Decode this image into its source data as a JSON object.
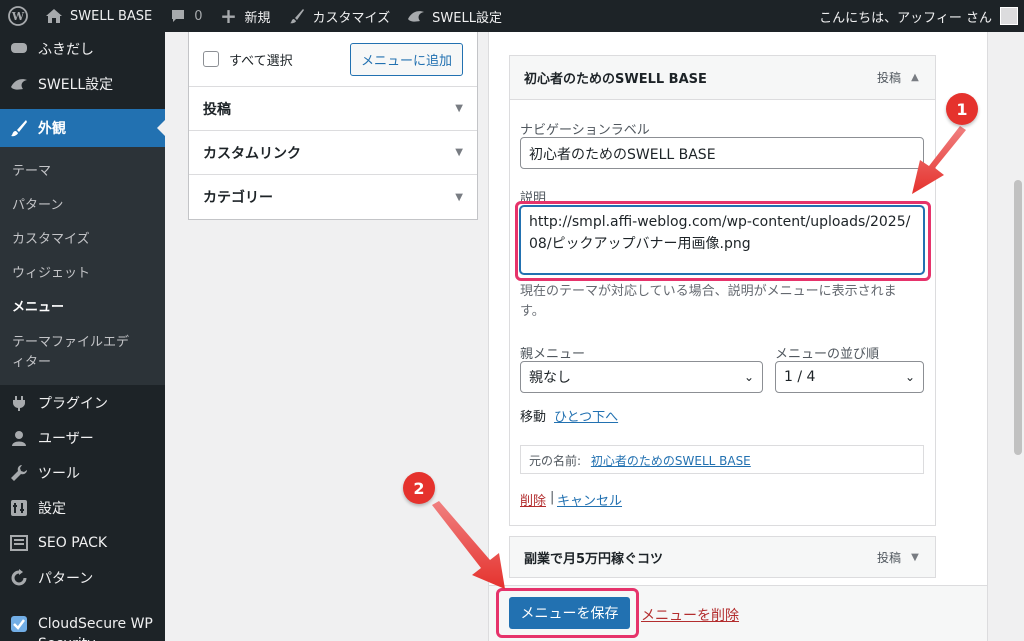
{
  "adminbar": {
    "site_name": "SWELL BASE",
    "comments_count": "0",
    "new_label": "新規",
    "customize_label": "カスタマイズ",
    "swell_settings_label": "SWELL設定",
    "greeting": "こんにちは、アッフィー さん"
  },
  "sidebar": {
    "items_top": [
      {
        "label": "ふきだし",
        "icon": "speech-bubble-icon"
      },
      {
        "label": "SWELL設定",
        "icon": "swell-icon"
      }
    ],
    "current": {
      "label": "外観",
      "icon": "paintbrush-icon"
    },
    "submenu": [
      "テーマ",
      "パターン",
      "カスタマイズ",
      "ウィジェット",
      "メニュー",
      "テーマファイルエディター"
    ],
    "submenu_active": "メニュー",
    "items_bottom": [
      {
        "label": "プラグイン",
        "icon": "plugin-icon"
      },
      {
        "label": "ユーザー",
        "icon": "user-icon"
      },
      {
        "label": "ツール",
        "icon": "wrench-icon"
      },
      {
        "label": "設定",
        "icon": "settings-icon"
      },
      {
        "label": "SEO PACK",
        "icon": "seo-icon"
      },
      {
        "label": "パターン",
        "icon": "pattern-icon"
      },
      {
        "label": "CloudSecure WP Security",
        "icon": "shield-icon"
      }
    ]
  },
  "left_panel": {
    "select_all": "すべて選択",
    "add_to_menu": "メニューに追加",
    "sections": [
      "投稿",
      "カスタムリンク",
      "カテゴリー"
    ]
  },
  "menu_item_1": {
    "title": "初心者のためのSWELL BASE",
    "type": "投稿",
    "nav_label_caption": "ナビゲーションラベル",
    "nav_label_value": "初心者のためのSWELL BASE",
    "description_caption": "説明",
    "description_value": "http://smpl.affi-weblog.com/wp-content/uploads/2025/08/ピックアップバナー用画像.png",
    "description_help": "現在のテーマが対応している場合、説明がメニューに表示されます。",
    "parent_caption": "親メニュー",
    "parent_value": "親なし",
    "order_caption": "メニューの並び順",
    "order_value": "1 / 4",
    "move_caption": "移動",
    "move_link": "ひとつ下へ",
    "original_caption": "元の名前:",
    "original_link": "初心者のためのSWELL BASE",
    "delete_link": "削除",
    "separator": "|",
    "cancel_link": "キャンセル"
  },
  "menu_item_2": {
    "title": "副業で月5万円稼ぐコツ",
    "type": "投稿"
  },
  "footer": {
    "save_button": "メニューを保存",
    "delete_menu": "メニューを削除"
  },
  "annotations": {
    "badge_1": "1",
    "badge_2": "2",
    "color": "#e5322d"
  }
}
